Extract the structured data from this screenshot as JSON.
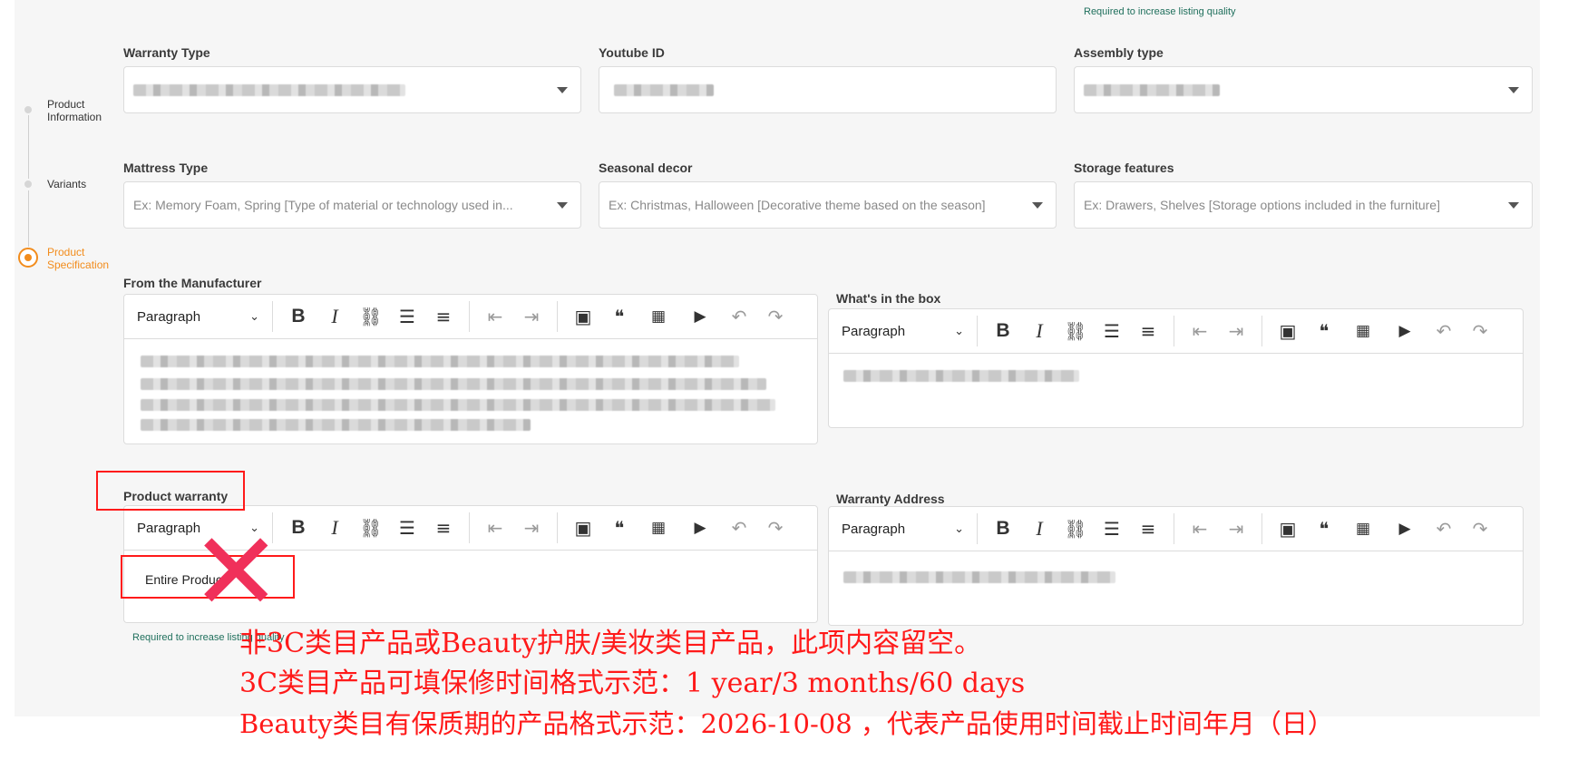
{
  "top_hint": "Required to increase listing quality",
  "stepper": {
    "steps": [
      {
        "label": "Product\nInformation",
        "state": "done"
      },
      {
        "label": "Variants",
        "state": "done"
      },
      {
        "label": "Product\nSpecification",
        "state": "active"
      }
    ]
  },
  "fields": {
    "warranty_type": {
      "label": "Warranty Type"
    },
    "youtube_id": {
      "label": "Youtube ID"
    },
    "assembly_type": {
      "label": "Assembly type"
    },
    "mattress_type": {
      "label": "Mattress Type",
      "placeholder": "Ex: Memory Foam, Spring [Type of material or technology used in..."
    },
    "seasonal_decor": {
      "label": "Seasonal decor",
      "placeholder": "Ex: Christmas, Halloween [Decorative theme based on the season]"
    },
    "storage_features": {
      "label": "Storage features",
      "placeholder": "Ex: Drawers, Shelves [Storage options included in the furniture]"
    }
  },
  "editors": {
    "paragraph_label": "Paragraph",
    "chevron": "⌄",
    "from_manufacturer": {
      "label": "From the Manufacturer"
    },
    "whats_in_box": {
      "label": "What's in the box"
    },
    "product_warranty": {
      "label": "Product warranty",
      "value": "Entire Produc",
      "hint": "Required to increase listing quality"
    },
    "warranty_address": {
      "label": "Warranty Address"
    }
  },
  "toolbar_icons": {
    "bold": "B",
    "italic": "I",
    "link": "⛓",
    "bullets": "☰",
    "numbered": "≡",
    "outdent": "⇤",
    "indent": "⇥",
    "image": "▣",
    "quote": "❝",
    "table": "▦",
    "media": "▶",
    "undo": "↶",
    "redo": "↷"
  },
  "annotation": {
    "lines": [
      "非3C类目产品或Beauty护肤/美妆类目产品，此项内容留空。",
      "3C类目产品可填保修时间格式示范：1 year/3 months/60 days",
      "Beauty类目有保质期的产品格式示范：2026-10-08 ，代表产品使用时间截止时间年月（日）"
    ],
    "mark": "✕",
    "color": "#ff1a1a"
  },
  "colors": {
    "accent": "#f28c1c",
    "hint": "#1f6f5c",
    "annotation": "#ff1a1a"
  }
}
